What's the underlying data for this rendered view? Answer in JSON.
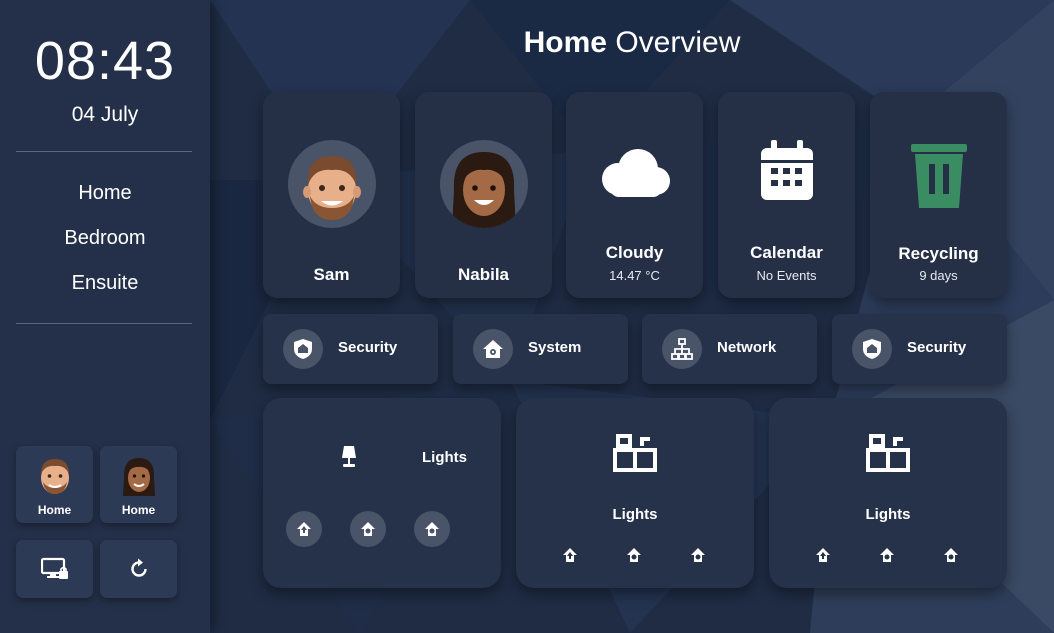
{
  "sidebar": {
    "time": "08:43",
    "date": "04 July",
    "nav": [
      {
        "label": "Home"
      },
      {
        "label": "Bedroom"
      },
      {
        "label": "Ensuite"
      }
    ],
    "people_buttons": [
      {
        "label": "Home",
        "avatar": "man-emoji-icon"
      },
      {
        "label": "Home",
        "avatar": "woman-emoji-icon"
      }
    ],
    "actions": [
      {
        "icon": "monitor-lock-icon"
      },
      {
        "icon": "refresh-icon"
      }
    ]
  },
  "header": {
    "title_bold": "Home",
    "title_light": "Overview"
  },
  "tiles": {
    "person1": {
      "name": "Sam"
    },
    "person2": {
      "name": "Nabila"
    },
    "weather": {
      "condition": "Cloudy",
      "temperature": "14.47 °C",
      "icon": "cloud-icon"
    },
    "calendar": {
      "name": "Calendar",
      "status": "No Events",
      "icon": "calendar-icon"
    },
    "recycling": {
      "name": "Recycling",
      "status": "9 days",
      "icon": "trash-bin-icon",
      "color": "#3a8d63"
    }
  },
  "services": [
    {
      "label": "Security",
      "icon": "shield-home-icon"
    },
    {
      "label": "System",
      "icon": "home-gear-icon"
    },
    {
      "label": "Network",
      "icon": "network-icon"
    },
    {
      "label": "Security",
      "icon": "shield-home-icon"
    }
  ],
  "lights": [
    {
      "label": "Lights",
      "icon": "lamp-icon"
    },
    {
      "label": "Lights",
      "icon": "lights-group-icon"
    },
    {
      "label": "Lights",
      "icon": "lights-group-icon"
    }
  ],
  "colors": {
    "sidebar": "#243049",
    "card": "#253047",
    "chip": "#4a5468",
    "accent_green": "#3a8d63"
  }
}
